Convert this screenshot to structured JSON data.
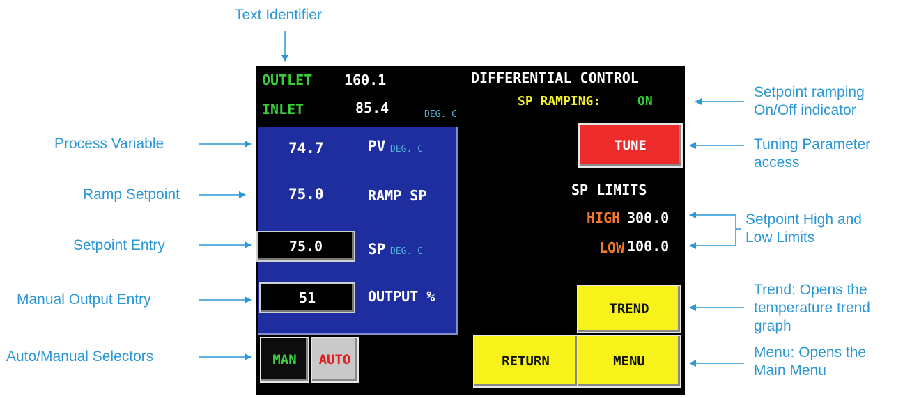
{
  "annotations": {
    "text_identifier": "Text Identifier",
    "process_variable": "Process Variable",
    "ramp_setpoint": "Ramp Setpoint",
    "setpoint_entry": "Setpoint Entry",
    "manual_output_entry": "Manual Output Entry",
    "auto_manual_selectors": "Auto/Manual Selectors",
    "setpoint_ramping": [
      "Setpoint ramping",
      "On/Off indicator"
    ],
    "tuning_access": [
      "Tuning Parameter",
      "access"
    ],
    "sp_limits": [
      "Setpoint High and",
      "Low Limits"
    ],
    "trend": [
      "Trend: Opens the",
      "temperature trend",
      "graph"
    ],
    "menu": [
      "Menu: Opens the",
      "Main Menu"
    ]
  },
  "screen": {
    "outlet_label": "OUTLET",
    "outlet_value": "160.1",
    "inlet_label": "INLET",
    "inlet_value": "85.4",
    "unit_deg_c": "DEG. C",
    "title": "DIFFERENTIAL CONTROL",
    "sp_ramping_label": "SP RAMPING:",
    "sp_ramping_state": "ON",
    "pv_value": "74.7",
    "pv_label": "PV",
    "pv_unit": "DEG. C",
    "ramp_sp_value": "75.0",
    "ramp_sp_label": "RAMP SP",
    "sp_value": "75.0",
    "sp_label": "SP",
    "sp_unit": "DEG. C",
    "output_value": "51",
    "output_label": "OUTPUT %",
    "tune_button": "TUNE",
    "sp_limits_title": "SP LIMITS",
    "high_label": "HIGH",
    "high_value": "300.0",
    "low_label": "LOW",
    "low_value": "100.0",
    "trend_button": "TREND",
    "return_button": "RETURN",
    "menu_button": "MENU",
    "man_button": "MAN",
    "auto_button": "AUTO"
  },
  "colors": {
    "annotation": "#2b97d6",
    "screen_background": "#000000",
    "panel_blue": "#1f2e9e",
    "button_yellow": "#f7f21a",
    "button_red": "#ee2c2c",
    "label_green": "#38d038",
    "label_orange": "#f07a2a"
  }
}
